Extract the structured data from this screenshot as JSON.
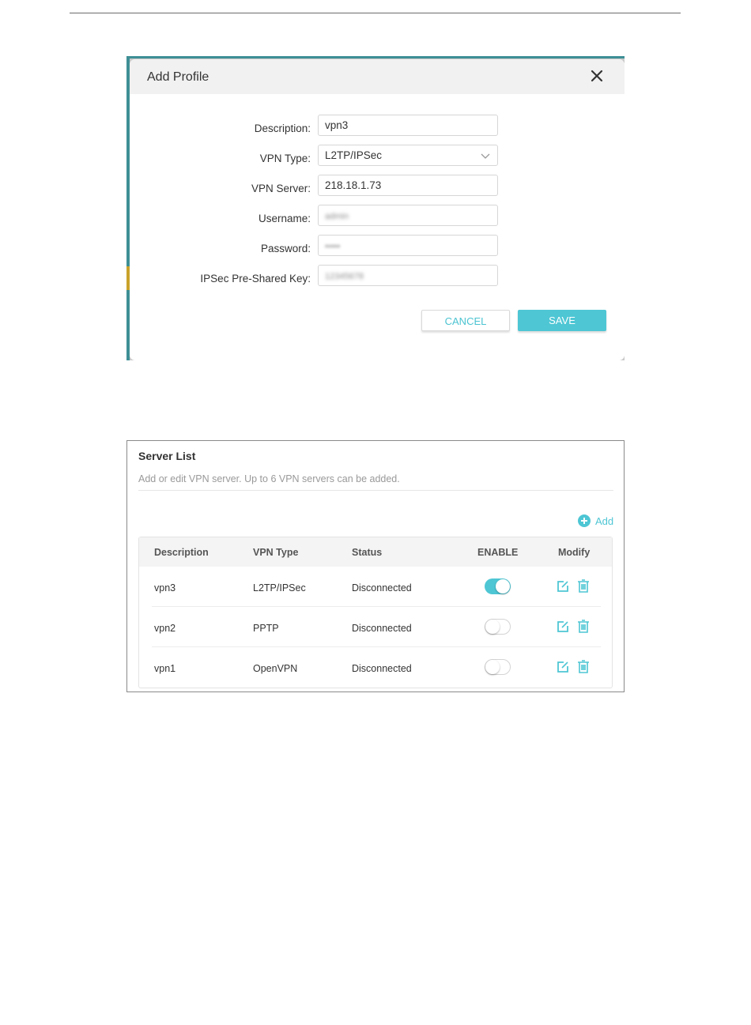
{
  "dialog": {
    "title": "Add Profile",
    "fields": [
      {
        "label": "Description:",
        "value": "vpn3"
      },
      {
        "label": "VPN Type:",
        "value": "L2TP/IPSec"
      },
      {
        "label": "VPN Server:",
        "value": "218.18.1.73"
      },
      {
        "label": "Username:",
        "value": "admin"
      },
      {
        "label": "Password:",
        "value": "•••••"
      },
      {
        "label": "IPSec Pre-Shared Key:",
        "value": "12345678"
      }
    ],
    "cancel_label": "CANCEL",
    "save_label": "SAVE"
  },
  "server_list": {
    "title": "Server List",
    "subtitle": "Add or edit VPN server. Up to 6 VPN servers can be added.",
    "add_label": "Add",
    "columns": [
      "Description",
      "VPN Type",
      "Status",
      "ENABLE",
      "Modify"
    ],
    "rows": [
      {
        "description": "vpn3",
        "vpn_type": "L2TP/IPSec",
        "status": "Disconnected",
        "enabled": true
      },
      {
        "description": "vpn2",
        "vpn_type": "PPTP",
        "status": "Disconnected",
        "enabled": false
      },
      {
        "description": "vpn1",
        "vpn_type": "OpenVPN",
        "status": "Disconnected",
        "enabled": false
      }
    ]
  },
  "colors": {
    "accent": "#4ec6d4",
    "header_strip": "#3e8f95"
  }
}
